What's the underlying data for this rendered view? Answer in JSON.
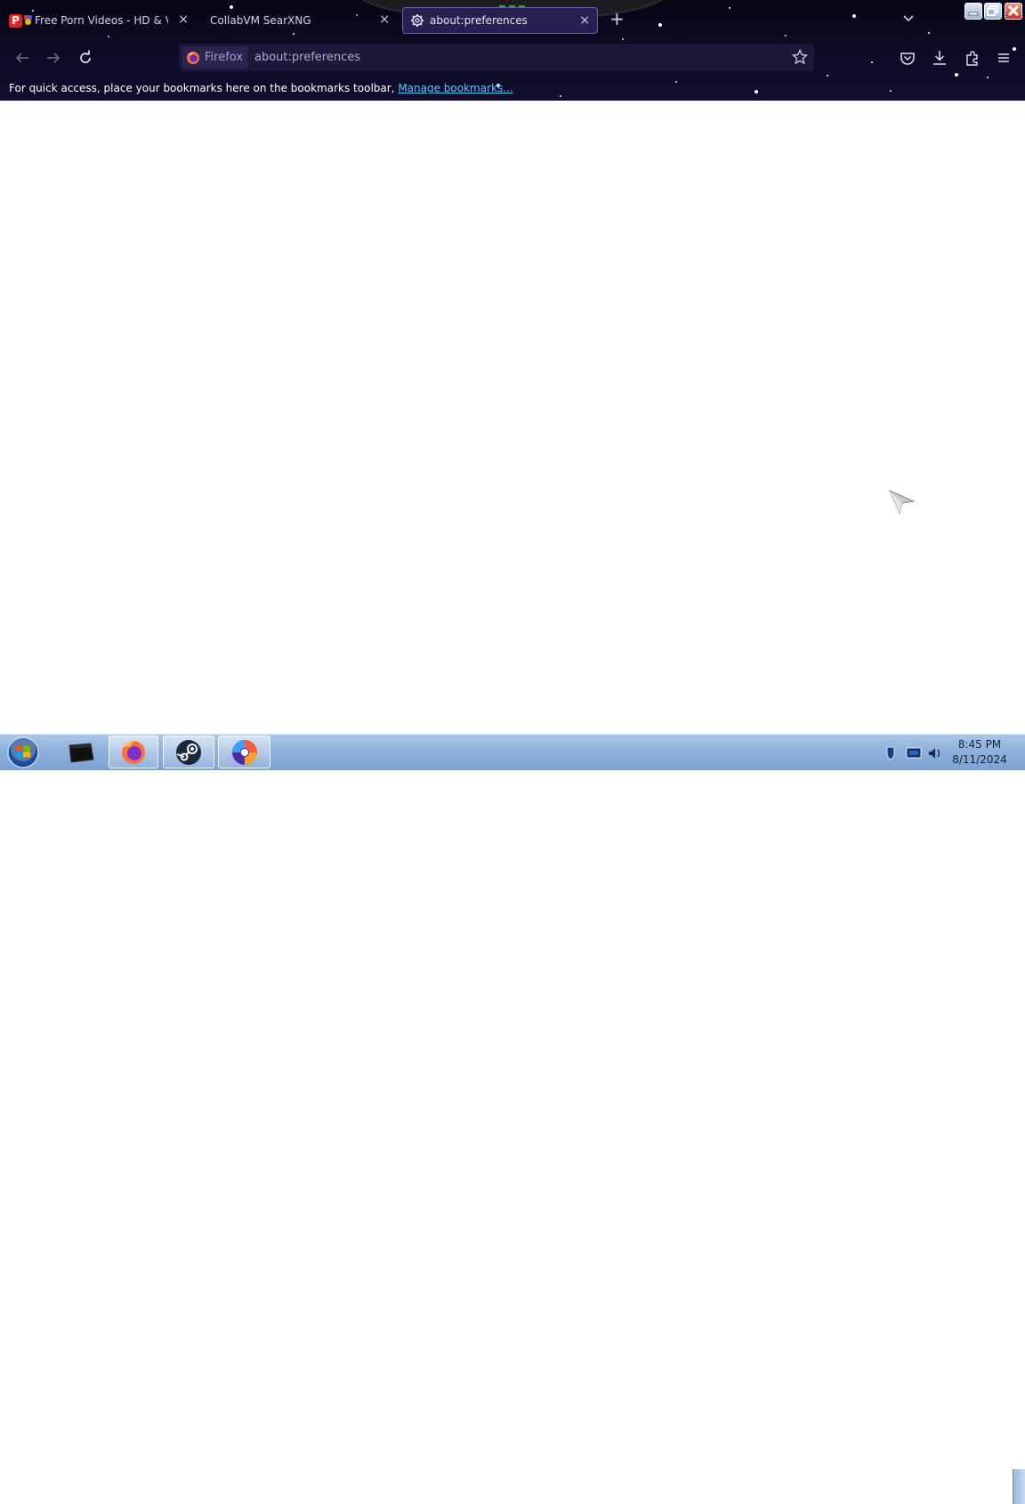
{
  "browser": {
    "tabs": [
      {
        "title": "Free Porn Videos - HD & VR",
        "close": "×",
        "icon": "pornhub-p-icon"
      },
      {
        "title": "CollabVM SearXNG",
        "close": "×",
        "icon": "none"
      },
      {
        "title": "about:preferences",
        "close": "×",
        "icon": "gear-icon",
        "active": true
      }
    ],
    "new_tab": "+",
    "url_identity": "Firefox",
    "url": "about:preferences",
    "bookmarks_bar": {
      "text": "For quick access, place your bookmarks here on the bookmarks toolbar,",
      "link": "Manage bookmarks..."
    },
    "theme_colors": {
      "accent": "#6d5fb2",
      "link": "#53c8ff"
    }
  },
  "taskbar": {
    "items": [
      "terminal",
      "firefox",
      "steam",
      "app"
    ],
    "clock_time": "8:45 PM",
    "clock_date": "8/11/2024"
  }
}
